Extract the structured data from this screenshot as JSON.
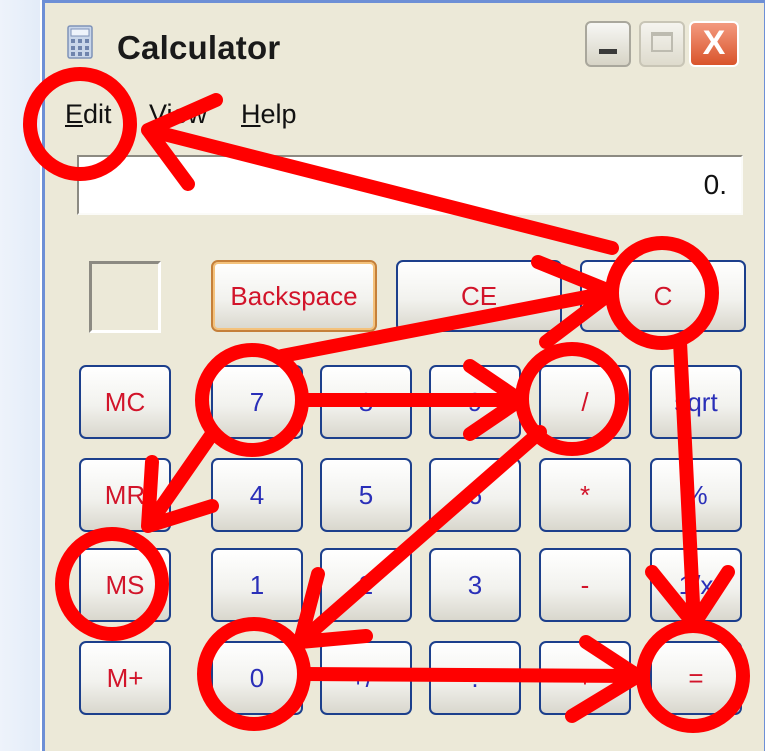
{
  "window": {
    "title": "Calculator",
    "close_glyph": "X"
  },
  "menu": {
    "items": [
      {
        "mnemonic": "E",
        "rest": "dit"
      },
      {
        "mnemonic": "V",
        "rest": "iew"
      },
      {
        "mnemonic": "H",
        "rest": "elp"
      }
    ]
  },
  "display": {
    "value": "0."
  },
  "keys": {
    "backspace": "Backspace",
    "ce": "CE",
    "c": "C",
    "mc": "MC",
    "mr": "MR",
    "ms": "MS",
    "mplus": "M+",
    "seven": "7",
    "eight": "8",
    "nine": "9",
    "divide": "/",
    "sqrt": "sqrt",
    "four": "4",
    "five": "5",
    "six": "6",
    "multiply": "*",
    "percent": "%",
    "one": "1",
    "two": "2",
    "three": "3",
    "minus": "-",
    "reciprocal": "1/x",
    "zero": "0",
    "plusminus": "+/-",
    "decimal": ".",
    "plus": "+",
    "equals": "="
  },
  "colors": {
    "annotation": "#ff0000",
    "red_key_text": "#d2142a",
    "blue_key_text": "#2a2fb8"
  }
}
